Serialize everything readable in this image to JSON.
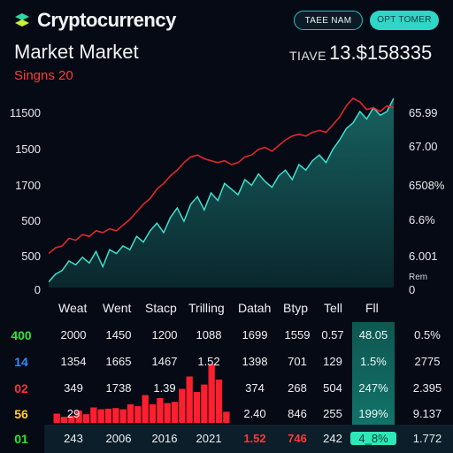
{
  "header": {
    "app_title": "Cryptocurrency",
    "trade_button": "TAEE NAM",
    "option_button": "OPT TOMER"
  },
  "market": {
    "title": "Market Market",
    "signals": "Singns 20",
    "price_label": "TIAVE",
    "price_value": "13.$158335"
  },
  "y_axis_left": [
    "11500",
    "1500",
    "1700",
    "500",
    "500",
    "0"
  ],
  "y_axis_right": [
    "65.99",
    "67.00",
    "6508%",
    "6.6%",
    "6.001",
    "Rem",
    "0"
  ],
  "table": {
    "columns": [
      "Weat",
      "Went",
      "Stacp",
      "Trilling",
      "Datah",
      "Btyp",
      "Tell",
      "Fll"
    ],
    "row_labels": [
      {
        "text": "400",
        "color": "#2ee62e"
      },
      {
        "text": "14",
        "color": "#2e8cff"
      },
      {
        "text": "02",
        "color": "#ff2e3c"
      },
      {
        "text": "56",
        "color": "#ffd21e"
      },
      {
        "text": "01",
        "color": "#2ee62e"
      }
    ],
    "rows": [
      [
        "2000",
        "1450",
        "1200",
        "1088",
        "1699",
        "1559",
        "0.57",
        "48.05",
        "0.5%"
      ],
      [
        "1354",
        "1665",
        "1467",
        "1.52",
        "1398",
        "701",
        "129",
        "1.5%",
        "2775"
      ],
      [
        "349",
        "1738",
        "1.39",
        "",
        "374",
        "268",
        "504",
        "247%",
        "2.395"
      ],
      [
        "29",
        "",
        "",
        "",
        "2.40",
        "846",
        "255",
        "199%",
        "9.137"
      ],
      [
        "243",
        "2006",
        "2016",
        "2021",
        "1.52",
        "746",
        "242",
        "4_8%",
        "1.772"
      ]
    ]
  },
  "colors": {
    "accent_teal": "#2fd6c8",
    "area_fill": "#0f4a4a",
    "line_red": "#e0282c",
    "bars_red": "#ff1f2e"
  },
  "chart_data": {
    "type": "area",
    "series": [
      {
        "values": [
          0.03,
          0.07,
          0.09,
          0.14,
          0.12,
          0.16,
          0.13,
          0.19,
          0.11,
          0.2,
          0.18,
          0.22,
          0.2,
          0.27,
          0.24,
          0.3,
          0.34,
          0.29,
          0.37,
          0.42,
          0.35,
          0.44,
          0.48,
          0.41,
          0.5,
          0.46,
          0.55,
          0.52,
          0.49,
          0.57,
          0.54,
          0.6,
          0.56,
          0.53,
          0.59,
          0.62,
          0.57,
          0.65,
          0.62,
          0.67,
          0.7,
          0.66,
          0.73,
          0.78,
          0.84,
          0.87,
          0.93,
          0.89,
          0.95,
          0.91,
          0.93,
          1.0
        ]
      },
      {
        "values": [
          0.18,
          0.21,
          0.22,
          0.26,
          0.25,
          0.28,
          0.27,
          0.3,
          0.29,
          0.31,
          0.3,
          0.33,
          0.36,
          0.4,
          0.44,
          0.47,
          0.52,
          0.55,
          0.59,
          0.62,
          0.66,
          0.69,
          0.7,
          0.68,
          0.67,
          0.66,
          0.67,
          0.65,
          0.66,
          0.69,
          0.7,
          0.73,
          0.74,
          0.72,
          0.75,
          0.78,
          0.8,
          0.81,
          0.8,
          0.82,
          0.83,
          0.82,
          0.86,
          0.9,
          0.96,
          1.0,
          0.98,
          0.94,
          0.95,
          0.93,
          0.96,
          0.95
        ]
      }
    ],
    "bars": [
      0.15,
      0.1,
      0.12,
      0.2,
      0.14,
      0.25,
      0.22,
      0.23,
      0.24,
      0.22,
      0.3,
      0.27,
      0.45,
      0.3,
      0.4,
      0.32,
      0.34,
      0.55,
      0.75,
      0.5,
      0.62,
      0.95,
      0.7,
      0.18
    ]
  }
}
